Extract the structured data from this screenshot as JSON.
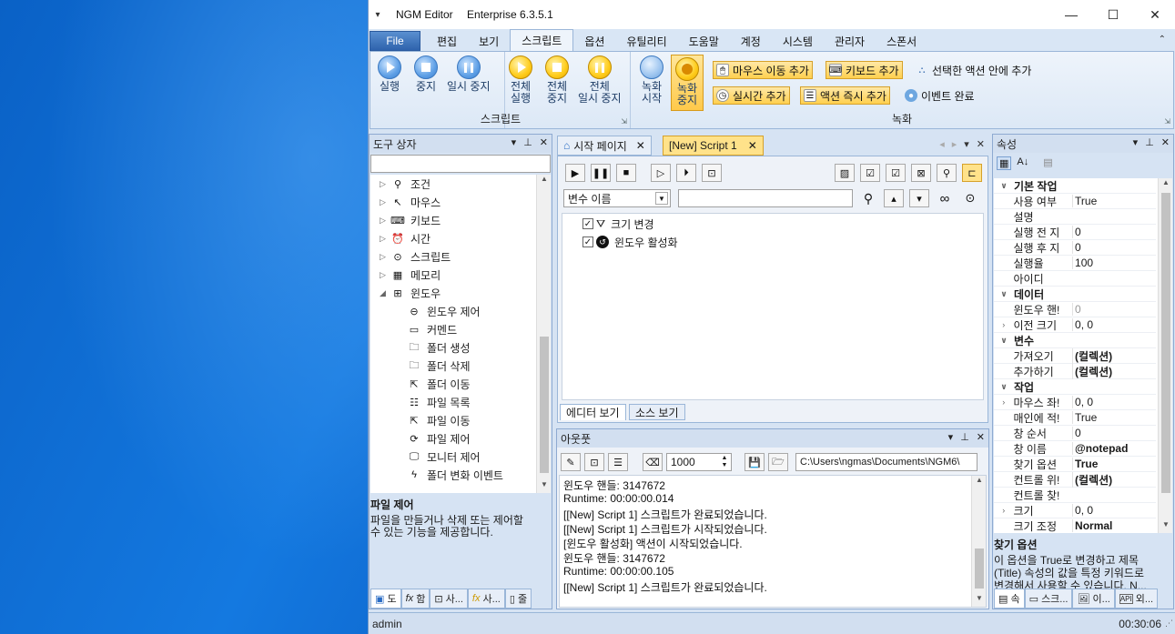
{
  "titlebar": {
    "app_name": "NGM Editor",
    "edition": "Enterprise 6.3.5.1",
    "minimize": "—",
    "maximize": "☐",
    "close": "✕"
  },
  "ribbon_tabs": [
    "File",
    "편집",
    "보기",
    "스크립트",
    "옵션",
    "유틸리티",
    "도움말",
    "계정",
    "시스템",
    "관리자",
    "스폰서"
  ],
  "ribbon": {
    "script_group": {
      "label": "스크립트",
      "run": "실행",
      "stop": "중지",
      "pause": "일시 중지"
    },
    "all_group": {
      "run_all": [
        "전체",
        "실행"
      ],
      "stop_all": [
        "전체",
        "중지"
      ],
      "pause_all": [
        "전체",
        "일시 중지"
      ]
    },
    "record_group": {
      "label": "녹화",
      "start": [
        "녹화",
        "시작"
      ],
      "stop": [
        "녹화",
        "중지"
      ],
      "add_mouse_move": "마우스 이동 추가",
      "add_keyboard": "키보드 추가",
      "add_in_selected": "선택한 액션 안에 추가",
      "add_realtime": "실시간 추가",
      "add_action_now": "액션 즉시 추가",
      "event_done": "이벤트 완료"
    }
  },
  "toolbox": {
    "title": "도구 상자",
    "items": [
      "조건",
      "마우스",
      "키보드",
      "시간",
      "스크립트",
      "메모리",
      "윈도우"
    ],
    "window_children": [
      "윈도우 제어",
      "커멘드",
      "폴더 생성",
      "폴더 삭제",
      "폴더 이동",
      "파일 목록",
      "파일 이동",
      "파일 제어",
      "모니터 제어",
      "폴더 변화 이벤트"
    ],
    "desc_title": "파일 제어",
    "desc_text": [
      "파일을 만들거나 삭제 또는 제어할",
      "수 있는 기능을 제공합니다."
    ],
    "bottom_tabs": [
      "도",
      "함",
      "사...",
      "사...",
      "줄"
    ]
  },
  "editor": {
    "tabs": [
      "시작 페이지",
      "[New] Script 1"
    ],
    "variable_dropdown": "변수 이름",
    "actions": [
      "크기 변경",
      "윈도우 활성화"
    ],
    "view_tabs": [
      "에디터 보기",
      "소스 보기"
    ]
  },
  "output": {
    "title": "아웃풋",
    "count": "1000",
    "path": "C:\\Users\\ngmas\\Documents\\NGM6\\",
    "lines": [
      "윈도우 핸들: 3147672",
      "Runtime: 00:00:00.014",
      "[[New] Script 1] 스크립트가 완료되었습니다.",
      "[[New] Script 1] 스크립트가 시작되었습니다.",
      "[윈도우 활성화] 액션이 시작되었습니다.",
      "윈도우 핸들: 3147672",
      "Runtime: 00:00:00.105",
      "[[New] Script 1] 스크립트가 완료되었습니다."
    ]
  },
  "properties": {
    "title": "속성",
    "rows": [
      {
        "cat": true,
        "key": "기본 작업",
        "val": ""
      },
      {
        "key": "사용 여부",
        "val": "True"
      },
      {
        "key": "설명",
        "val": ""
      },
      {
        "key": "실행 전 지",
        "val": "0"
      },
      {
        "key": "실행 후 지",
        "val": "0"
      },
      {
        "key": "실행율",
        "val": "100"
      },
      {
        "key": "아이디",
        "val": ""
      },
      {
        "cat": true,
        "key": "데이터",
        "val": ""
      },
      {
        "key": "윈도우 핸!",
        "val": "0",
        "gray": true
      },
      {
        "key": "이전 크기",
        "val": "0, 0",
        "exp": true
      },
      {
        "cat": true,
        "key": "변수",
        "val": ""
      },
      {
        "key": "가져오기",
        "val": "(컬렉션)",
        "bold": true
      },
      {
        "key": "추가하기",
        "val": "(컬렉션)",
        "bold": true
      },
      {
        "cat": true,
        "key": "작업",
        "val": ""
      },
      {
        "key": "마우스 좌!",
        "val": "0, 0",
        "exp": true
      },
      {
        "key": "매인에 적!",
        "val": "True"
      },
      {
        "key": "창 순서",
        "val": "0"
      },
      {
        "key": "창 이름",
        "val": "@notepad",
        "bold": true
      },
      {
        "key": "찾기 옵션",
        "val": "True",
        "bold": true
      },
      {
        "key": "컨트롤 위!",
        "val": "(컬렉션)",
        "bold": true
      },
      {
        "key": "컨트롤 찾!",
        "val": ""
      },
      {
        "key": "크기",
        "val": "0, 0",
        "exp": true
      },
      {
        "key": "크기 조정",
        "val": "Normal",
        "bold": true
      }
    ],
    "desc_title": "찾기 옵션",
    "desc_text": [
      "이 옵션을 True로 변경하고 제목",
      "(Title) 속성의 값을 특정 키워드로",
      "변경해서 사용할 수 있습니다. N..."
    ],
    "bottom_tabs": [
      "속",
      "스크...",
      "이...",
      "외..."
    ]
  },
  "status": {
    "user": "admin",
    "time": "00:30:06"
  }
}
